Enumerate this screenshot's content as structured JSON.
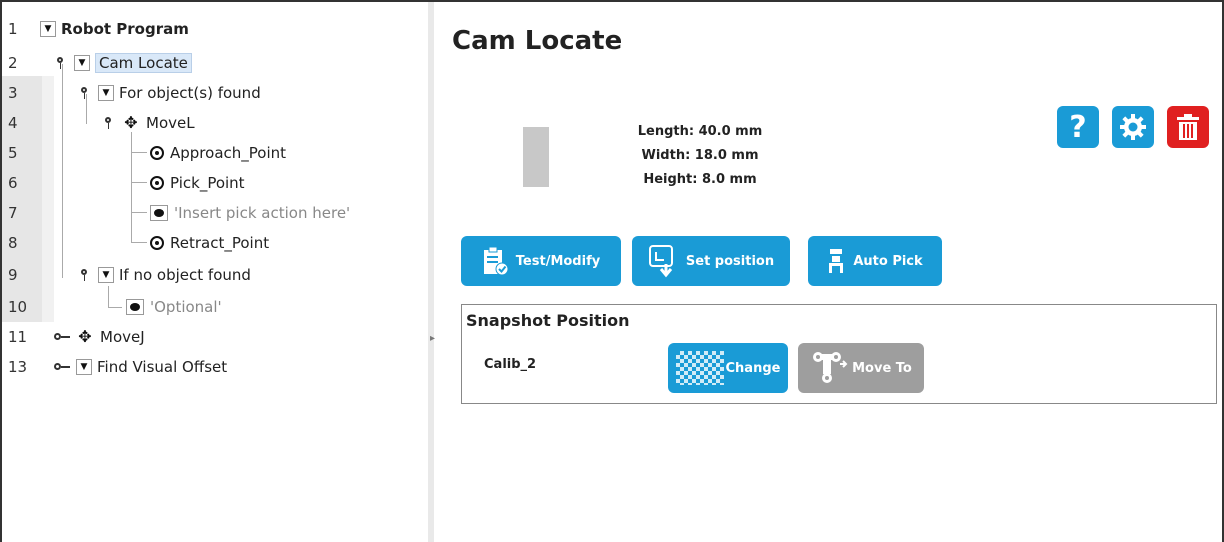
{
  "tree": [
    {
      "line": "1",
      "label": "Robot Program"
    },
    {
      "line": "2",
      "label": "Cam Locate"
    },
    {
      "line": "3",
      "label": "For object(s) found"
    },
    {
      "line": "4",
      "label": "MoveL"
    },
    {
      "line": "5",
      "label": "Approach_Point"
    },
    {
      "line": "6",
      "label": "Pick_Point"
    },
    {
      "line": "7",
      "label": "'Insert pick action here'"
    },
    {
      "line": "8",
      "label": "Retract_Point"
    },
    {
      "line": "9",
      "label": "If no object found"
    },
    {
      "line": "10",
      "label": "'Optional'"
    },
    {
      "line": "11",
      "label": "MoveJ"
    },
    {
      "line": "13",
      "label": "Find Visual Offset"
    }
  ],
  "main": {
    "title": "Cam Locate",
    "dims": {
      "length": "Length: 40.0 mm",
      "width": "Width: 18.0 mm",
      "height": "Height: 8.0 mm"
    },
    "buttons": {
      "help": "?",
      "test_modify": "Test/Modify",
      "set_position": "Set position",
      "auto_pick": "Auto Pick"
    },
    "snapshot": {
      "title": "Snapshot Position",
      "calib": "Calib_2",
      "change": "Change",
      "move_to": "Move To"
    }
  },
  "colors": {
    "accent": "#1a9bd6",
    "danger": "#e02020",
    "disabled": "#9e9e9e",
    "selection": "#d9e8f8"
  },
  "icons": [
    "toggle-expand-icon",
    "pin-icon",
    "move-cross-icon",
    "waypoint-icon",
    "comment-icon",
    "help-icon",
    "gear-icon",
    "trash-icon",
    "clipboard-check-icon",
    "set-position-icon",
    "gripper-icon",
    "checker-icon",
    "robot-arm-icon"
  ]
}
